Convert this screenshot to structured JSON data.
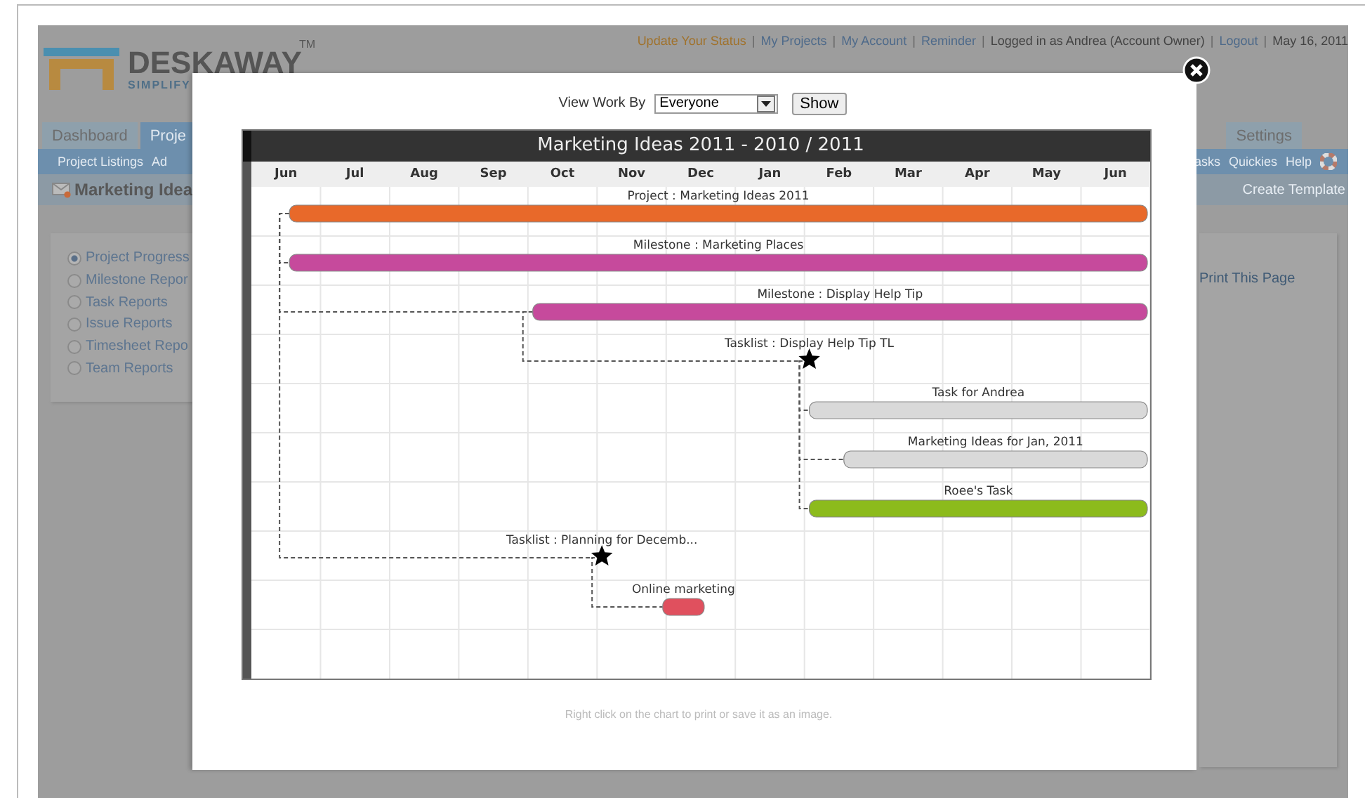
{
  "page": {
    "logo": {
      "name": "DESKAWAY",
      "trademark": "TM",
      "tagline": "SIMPLIFY"
    },
    "top_links": [
      {
        "label": "Update Your Status",
        "kind": "status"
      },
      {
        "label": "|",
        "kind": "separator"
      },
      {
        "label": "My Projects",
        "kind": "link"
      },
      {
        "label": "|",
        "kind": "separator"
      },
      {
        "label": "My Account",
        "kind": "link"
      },
      {
        "label": "|",
        "kind": "separator"
      },
      {
        "label": "Reminder",
        "kind": "link"
      },
      {
        "label": "|",
        "kind": "separator"
      },
      {
        "label": "Logged in as Andrea (Account Owner)",
        "kind": "text"
      },
      {
        "label": "|",
        "kind": "separator"
      },
      {
        "label": "Logout",
        "kind": "link"
      },
      {
        "label": "|",
        "kind": "separator"
      },
      {
        "label": "May 16, 2011",
        "kind": "text"
      }
    ],
    "tabs": [
      {
        "label": "Dashboard",
        "selected": false
      },
      {
        "label": "Proje",
        "selected": true
      }
    ],
    "right_tabs": [
      {
        "label": "Settings",
        "selected": false
      }
    ],
    "subnav_left": [
      "Project Listings",
      "Ad"
    ],
    "subnav_right": [
      "asks",
      "Quickies",
      "Help"
    ],
    "title": "Marketing Idea",
    "title_action": "Create Template",
    "reports": [
      {
        "label": "Project Progress",
        "selected": true
      },
      {
        "label": "Milestone Repor",
        "selected": false
      },
      {
        "label": "Task Reports",
        "selected": false
      },
      {
        "label": "Issue Reports",
        "selected": false
      },
      {
        "label": "Timesheet Repo",
        "selected": false
      },
      {
        "label": "Team Reports",
        "selected": false
      }
    ],
    "print_link": "Print This Page"
  },
  "dialog": {
    "view_label": "View Work By",
    "view_value": "Everyone",
    "show_button": "Show",
    "gantt": {
      "title": "Marketing Ideas 2011 - 2010 / 2011",
      "months": [
        "Jun",
        "Jul",
        "Aug",
        "Sep",
        "Oct",
        "Nov",
        "Dec",
        "Jan",
        "Feb",
        "Mar",
        "Apr",
        "May",
        "Jun"
      ],
      "items": [
        {
          "kind": "project",
          "label": "Project : Marketing Ideas 2011",
          "color": "#e8692a",
          "children": [
            {
              "kind": "milestone",
              "label": "Milestone : Marketing Places",
              "color": "#c64a9c"
            },
            {
              "kind": "milestone",
              "label": "Milestone : Display Help Tip",
              "color": "#c64a9c",
              "children": [
                {
                  "kind": "tasklist",
                  "label": "Tasklist : Display Help Tip TL",
                  "children": [
                    {
                      "kind": "task",
                      "label": "Task for Andrea",
                      "color": "#d9d9d9"
                    },
                    {
                      "kind": "task",
                      "label": "Marketing Ideas for Jan, 2011",
                      "color": "#d9d9d9"
                    },
                    {
                      "kind": "task",
                      "label": "Roee's Task",
                      "color": "#8cbb1c"
                    }
                  ]
                }
              ]
            },
            {
              "kind": "tasklist",
              "label": "Tasklist : Planning for Decemb...",
              "children": [
                {
                  "kind": "task",
                  "label": "Online marketing",
                  "color": "#e0505e"
                }
              ]
            }
          ]
        }
      ]
    },
    "footnote": "Right click on the chart to print or save it as an image."
  }
}
